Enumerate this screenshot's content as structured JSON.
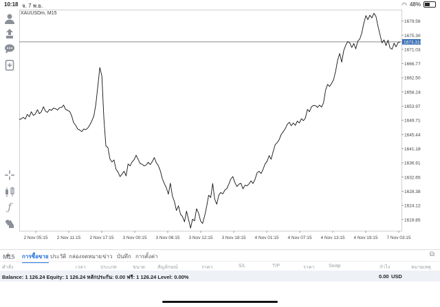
{
  "status": {
    "time": "10:18",
    "date": "จ. 7 พ.ย.",
    "battery": "48%"
  },
  "sidebar": {
    "items": [
      {
        "name": "account-icon"
      },
      {
        "name": "trade-icon"
      },
      {
        "name": "chat-icon"
      },
      {
        "name": "add-document-icon"
      },
      {
        "name": "crosshair-icon"
      },
      {
        "name": "chart-type-icon"
      },
      {
        "name": "indicators-icon"
      },
      {
        "name": "objects-icon"
      }
    ],
    "timeframe": "M15"
  },
  "chart": {
    "symbol": "XAUUSDm, M15",
    "current_price_label": "1673.310",
    "colors": {
      "line": "#111111",
      "grid": "#e6e6e6",
      "price_line": "#7a7a7a",
      "price_tag": "#3a6fb5"
    }
  },
  "chart_data": {
    "type": "line",
    "xlabels": [
      "2 Nov 05:15",
      "2 Nov 11:15",
      "2 Nov 17:15",
      "3 Nov 00:15",
      "3 Nov 06:15",
      "3 Nov 12:15",
      "3 Nov 18:15",
      "4 Nov 01:15",
      "4 Nov 07:15",
      "4 Nov 13:15",
      "4 Nov 19:15",
      "7 Nov 03:15"
    ],
    "yticks": [
      "1679.565",
      "1675.300",
      "1671.035",
      "1666.770",
      "1662.505",
      "1658.240",
      "1653.975",
      "1649.710",
      "1645.445",
      "1641.180",
      "1636.915",
      "1632.650",
      "1628.385",
      "1624.120",
      "1619.855"
    ],
    "ylim": [
      1616.5,
      1683.0
    ],
    "current_price": 1673.31,
    "values": [
      1649.9,
      1650.2,
      1650.6,
      1650.1,
      1651.5,
      1650.8,
      1652.3,
      1651.2,
      1651.6,
      1652.9,
      1651.7,
      1652.3,
      1653.8,
      1652.5,
      1652.1,
      1653.0,
      1652.7,
      1653.4,
      1653.2,
      1652.8,
      1653.5,
      1653.6,
      1654.3,
      1653.0,
      1652.7,
      1652.4,
      1651.1,
      1649.0,
      1648.2,
      1647.1,
      1646.8,
      1646.3,
      1647.1,
      1646.9,
      1647.4,
      1648.3,
      1649.5,
      1651.0,
      1654.5,
      1660.0,
      1665.6,
      1663.0,
      1650.3,
      1642.0,
      1641.5,
      1638.1,
      1637.2,
      1637.8,
      1635.0,
      1634.2,
      1632.8,
      1633.5,
      1634.4,
      1633.0,
      1636.6,
      1636.0,
      1637.2,
      1637.9,
      1639.2,
      1638.0,
      1636.7,
      1636.5,
      1636.0,
      1636.3,
      1637.1,
      1636.4,
      1637.3,
      1638.5,
      1637.0,
      1636.1,
      1634.5,
      1632.2,
      1630.7,
      1629.4,
      1627.5,
      1630.8,
      1626.9,
      1625.3,
      1622.6,
      1624.0,
      1621.5,
      1620.8,
      1619.2,
      1622.4,
      1619.9,
      1617.3,
      1620.0,
      1619.5,
      1623.1,
      1621.8,
      1619.4,
      1618.7,
      1621.0,
      1623.8,
      1627.2,
      1626.5,
      1630.7,
      1626.0,
      1624.5,
      1627.2,
      1628.0,
      1627.6,
      1628.7,
      1629.2,
      1630.5,
      1632.1,
      1632.8,
      1631.0,
      1629.8,
      1630.5,
      1630.8,
      1629.1,
      1630.2,
      1630.0,
      1630.6,
      1631.5,
      1630.7,
      1632.0,
      1633.9,
      1634.4,
      1633.7,
      1635.0,
      1636.6,
      1637.4,
      1639.1,
      1638.0,
      1640.3,
      1642.4,
      1643.0,
      1643.9,
      1645.5,
      1646.3,
      1647.2,
      1648.5,
      1649.1,
      1648.1,
      1648.9,
      1648.2,
      1649.5,
      1648.9,
      1650.2,
      1649.6,
      1650.4,
      1653.0,
      1652.3,
      1653.8,
      1654.2,
      1654.1,
      1653.6,
      1654.3,
      1653.7,
      1655.0,
      1658.7,
      1660.5,
      1659.9,
      1660.8,
      1662.0,
      1664.5,
      1667.8,
      1669.8,
      1667.2,
      1670.6,
      1672.3,
      1673.4,
      1673.0,
      1671.6,
      1672.8,
      1671.2,
      1673.5,
      1674.2,
      1676.0,
      1678.9,
      1681.2,
      1680.0,
      1681.3,
      1680.5,
      1681.9,
      1681.0,
      1678.0,
      1675.5,
      1673.0,
      1673.9,
      1672.2,
      1673.8,
      1671.5,
      1671.1,
      1672.9,
      1671.8,
      1673.1,
      1673.3
    ]
  },
  "trade_tabs": [
    "การซื้อขาย",
    "ประวัติ",
    "กล่องจดหมาย",
    "ข่าว",
    "บันทึก",
    "การตั้งค่า"
  ],
  "columns": [
    "คำสั่ง",
    "เวลา",
    "ประเภท",
    "ขนาด",
    "สัญลักษณ์",
    "ราคา",
    "S/L",
    "T/P",
    "ราคา",
    "Swap",
    "กำไร",
    "หมายเหตุ"
  ],
  "balance": {
    "text": "Balance: 1 126.24 Equity: 1 126.24 หลักประกัน: 0.00 ฟรี: 1 126.24 Level: 0.00%",
    "profit": "0.00",
    "currency": "USD"
  }
}
